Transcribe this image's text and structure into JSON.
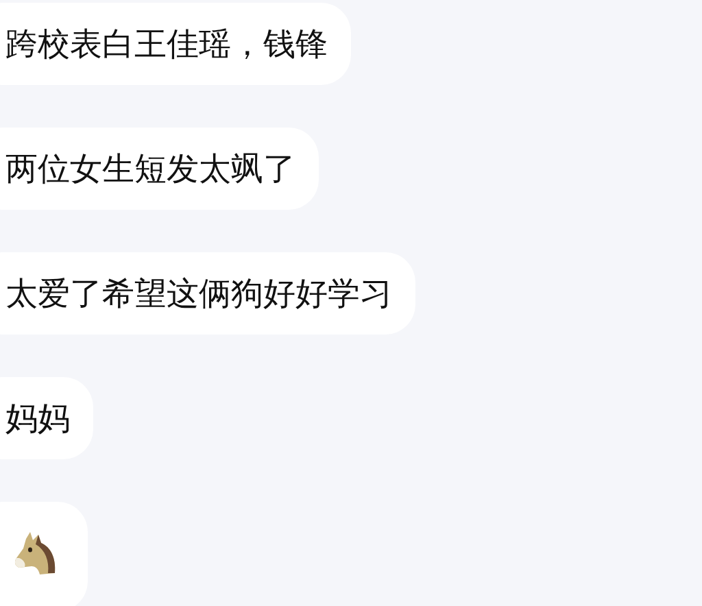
{
  "messages": [
    {
      "kind": "text",
      "text": "跨校表白王佳瑶，钱锋"
    },
    {
      "kind": "text",
      "text": "两位女生短发太飒了"
    },
    {
      "kind": "text",
      "text": "太爱了希望这俩狗好好学习"
    },
    {
      "kind": "text",
      "text": "妈妈"
    },
    {
      "kind": "emoji"
    }
  ]
}
